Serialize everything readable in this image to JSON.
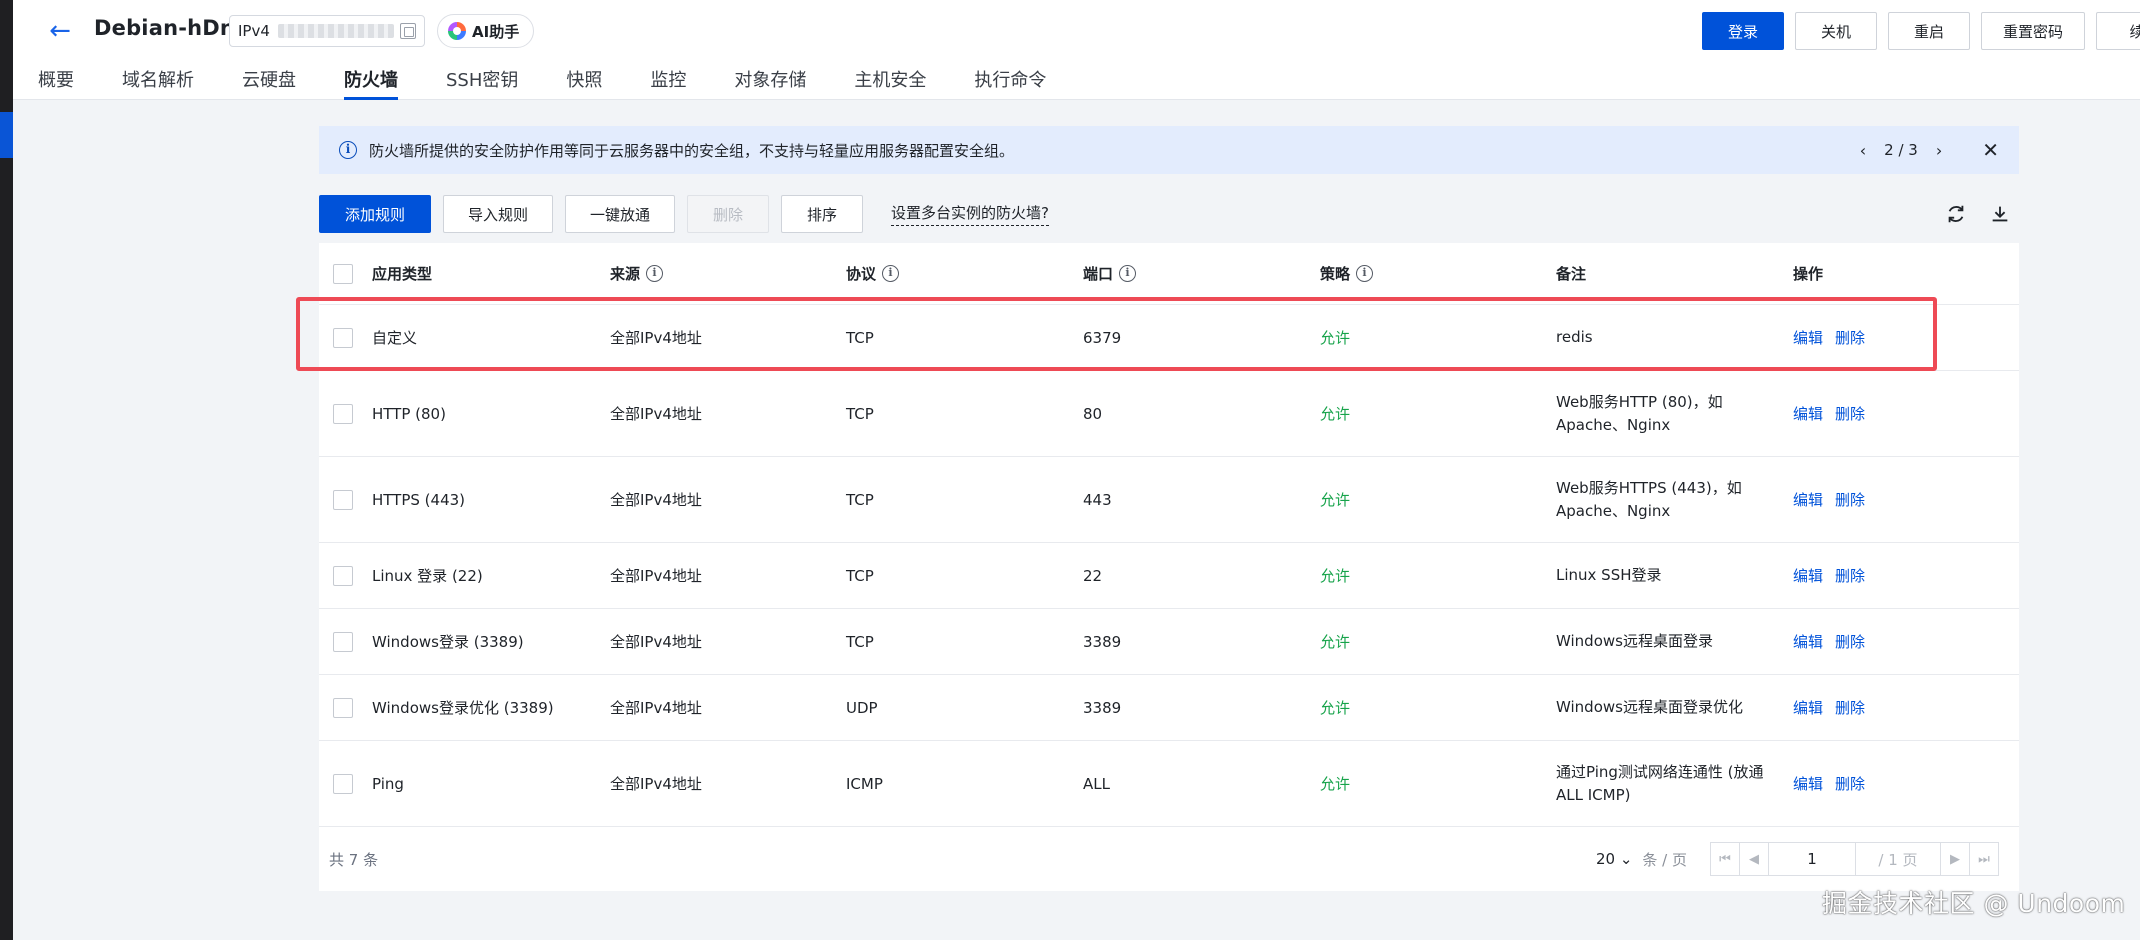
{
  "header": {
    "instance_name": "Debian-hDne",
    "ip_label": "IPv4",
    "ai_label": "AI助手",
    "actions": [
      "登录",
      "关机",
      "重启",
      "重置密码",
      "续"
    ]
  },
  "tabs": [
    {
      "label": "概要"
    },
    {
      "label": "域名解析"
    },
    {
      "label": "云硬盘"
    },
    {
      "label": "防火墙",
      "active": true
    },
    {
      "label": "SSH密钥"
    },
    {
      "label": "快照"
    },
    {
      "label": "监控"
    },
    {
      "label": "对象存储"
    },
    {
      "label": "主机安全"
    },
    {
      "label": "执行命令"
    }
  ],
  "notice": {
    "text": "防火墙所提供的安全防护作用等同于云服务器中的安全组，不支持与轻量应用服务器配置安全组。",
    "page": "2 / 3"
  },
  "toolbar": {
    "add": "添加规则",
    "import": "导入规则",
    "open_all": "一键放通",
    "delete": "删除",
    "sort": "排序",
    "multi": "设置多台实例的防火墙?"
  },
  "table": {
    "columns": [
      "应用类型",
      "来源",
      "协议",
      "端口",
      "策略",
      "备注",
      "操作"
    ],
    "edit": "编辑",
    "delete": "删除",
    "rows": [
      {
        "type": "自定义",
        "source": "全部IPv4地址",
        "protocol": "TCP",
        "port": "6379",
        "policy": "允许",
        "note": [
          "redis"
        ]
      },
      {
        "type": "HTTP (80)",
        "source": "全部IPv4地址",
        "protocol": "TCP",
        "port": "80",
        "policy": "允许",
        "note": [
          "Web服务HTTP (80)，如",
          "Apache、Nginx"
        ]
      },
      {
        "type": "HTTPS (443)",
        "source": "全部IPv4地址",
        "protocol": "TCP",
        "port": "443",
        "policy": "允许",
        "note": [
          "Web服务HTTPS (443)，如",
          "Apache、Nginx"
        ]
      },
      {
        "type": "Linux 登录 (22)",
        "source": "全部IPv4地址",
        "protocol": "TCP",
        "port": "22",
        "policy": "允许",
        "note": [
          "Linux SSH登录"
        ]
      },
      {
        "type": "Windows登录 (3389)",
        "source": "全部IPv4地址",
        "protocol": "TCP",
        "port": "3389",
        "policy": "允许",
        "note": [
          "Windows远程桌面登录"
        ]
      },
      {
        "type": "Windows登录优化 (3389)",
        "source": "全部IPv4地址",
        "protocol": "UDP",
        "port": "3389",
        "policy": "允许",
        "note": [
          "Windows远程桌面登录优化"
        ]
      },
      {
        "type": "Ping",
        "source": "全部IPv4地址",
        "protocol": "ICMP",
        "port": "ALL",
        "policy": "允许",
        "note": [
          "通过Ping测试网络连通性 (放通",
          "ALL ICMP)"
        ]
      }
    ]
  },
  "footer": {
    "total": "共 7 条",
    "page_size": "20",
    "per_page": "条 / 页",
    "current_page": "1",
    "total_pages": "/ 1 页"
  },
  "watermark": "掘金技术社区 @ Undoom"
}
